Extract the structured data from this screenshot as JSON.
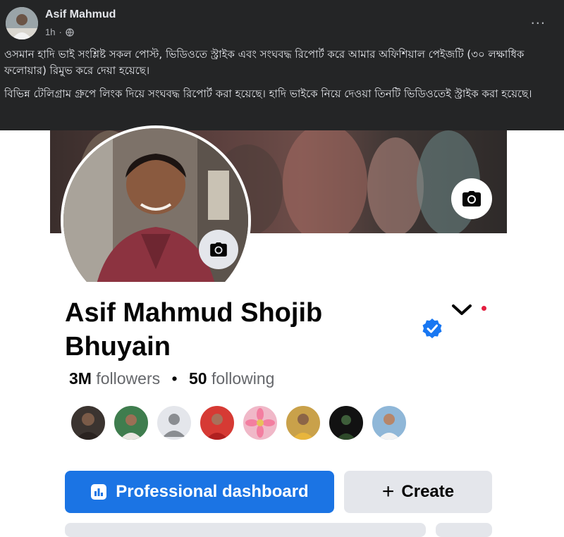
{
  "post": {
    "author": "Asif Mahmud",
    "time": "1h",
    "dot": "·",
    "more": "...",
    "paragraphs": [
      "ওসমান হাদি ভাই সংশ্লিষ্ট সকল পোস্ট, ভিডিওতে স্ট্রাইক এবং সংঘবদ্ধ রিপোর্ট করে আমার অফিশিয়াল পেইজটি (৩০ লক্ষাধিক ফলোয়ার) রিমুভ করে দেয়া হয়েছে।",
      "বিভিন্ন টেলিগ্রাম গ্রুপে লিংক দিয়ে সংঘবদ্ধ রিপোর্ট করা হয়েছে। হাদি ভাইকে নিয়ে দেওয়া তিনটি ভিডিওতেই স্ট্রাইক করা হয়েছে।"
    ]
  },
  "profile": {
    "name": "Asif Mahmud Shojib Bhuyain",
    "followers_count": "3M",
    "followers_label": "followers",
    "separator": "•",
    "following_count": "50",
    "following_label": "following",
    "verified_color": "#1877f2"
  },
  "buttons": {
    "dashboard_label": "Professional dashboard",
    "create_label": "Create",
    "create_icon": "+"
  },
  "colors": {
    "primary": "#1b74e4",
    "dark_bg": "#242526",
    "secondary_btn": "#e4e6eb"
  }
}
